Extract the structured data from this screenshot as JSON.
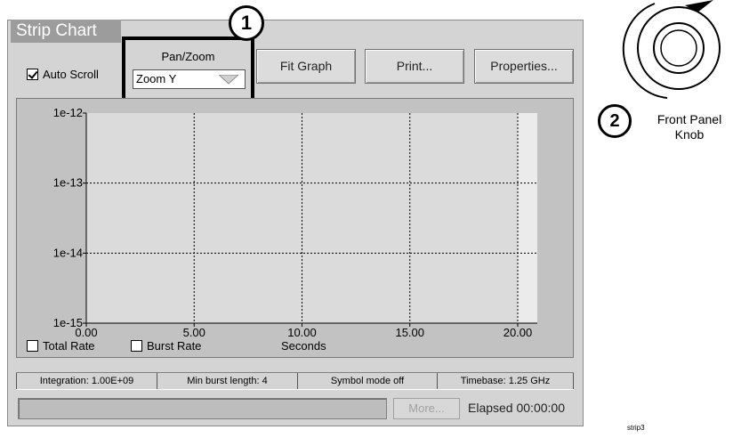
{
  "window": {
    "title": "Strip Chart"
  },
  "auto_scroll": {
    "label": "Auto Scroll",
    "checked": true
  },
  "pan_zoom": {
    "label": "Pan/Zoom",
    "selected": "Zoom Y"
  },
  "buttons": {
    "fit_graph": "Fit Graph",
    "print": "Print...",
    "properties": "Properties..."
  },
  "callouts": {
    "one": "1",
    "two": "2"
  },
  "chart_data": {
    "type": "line",
    "xlabel": "Seconds",
    "ylabel": "",
    "x_ticks": [
      "0.00",
      "5.00",
      "10.00",
      "15.00",
      "20.00"
    ],
    "y_ticks": [
      "1e-12",
      "1e-13",
      "1e-14",
      "1e-15"
    ],
    "xlim": [
      0,
      20
    ],
    "ylim": [
      1e-15,
      1e-12
    ],
    "y_scale": "log",
    "grid": true,
    "series": []
  },
  "legend": {
    "total_rate": "Total Rate",
    "burst_rate": "Burst Rate"
  },
  "status": {
    "integration": "Integration: 1.00E+09",
    "min_burst": "Min burst length: 4",
    "symbol_mode": "Symbol mode off",
    "timebase": "Timebase: 1.25 GHz"
  },
  "footer": {
    "more": "More...",
    "elapsed": "Elapsed 00:00:00"
  },
  "knob": {
    "label_line1": "Front Panel",
    "label_line2": "Knob"
  },
  "ref_tag": "strip3"
}
